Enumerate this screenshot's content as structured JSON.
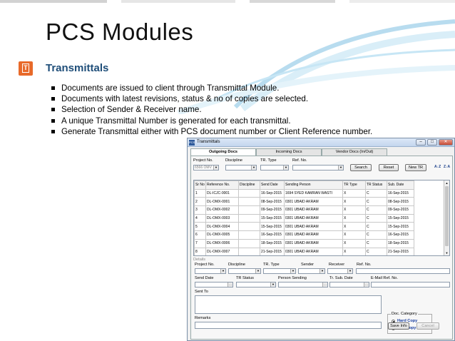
{
  "slide": {
    "title": "PCS Modules",
    "section_icon": "document-icon",
    "section_title": "Transmittals",
    "bullets": [
      "Documents are issued to client through Transmittal Module.",
      "Documents with latest revisions, status & no of copies are selected.",
      "Selection of Sender & Receiver name.",
      "A unique Transmittal Number is generated for each transmittal.",
      "Generate Transmittal either with PCS document number or Client Reference number."
    ],
    "colors": {
      "title": "#111111",
      "section_title": "#1f4e79",
      "icon_bg": "#e86a2a"
    }
  },
  "window": {
    "title": "Transmittals",
    "app_icon": "PCS",
    "buttons": {
      "minimize": "–",
      "restore": "□",
      "close": "✕"
    },
    "tabs": [
      {
        "label": "Outgoing Docs",
        "active": true
      },
      {
        "label": "Incoming Docs",
        "active": false
      },
      {
        "label": "Vendor Docs (In/Out)",
        "active": false
      }
    ],
    "filters": {
      "project_no_label": "Project No.",
      "project_no_value": "6566 OMV",
      "discipline_label": "Discipline",
      "tr_type_label": "TR. Type",
      "ref_no_label": "Ref. No.",
      "search_button": "Search",
      "reset_button": "Reset",
      "new_tr_button": "New TR",
      "sort_asc": "A↓Z",
      "sort_desc": "Z↓A"
    },
    "grid": {
      "columns": [
        "Sr No",
        "Reference No.",
        "Discipline",
        "Send Date",
        "Sending Person",
        "TR Type",
        "TR Status",
        "Sub. Date"
      ],
      "rows": [
        [
          "1",
          "DL-ICJC-0001",
          "",
          "16-Sep-2015",
          "1694 SYED KAMRAN WASTI",
          "X",
          "C",
          "16-Sep-2015"
        ],
        [
          "2",
          "DL-OMX-0001",
          "",
          "08-Sep-2015",
          "0301 UBAID AKRAM",
          "X",
          "C",
          "08-Sep-2015"
        ],
        [
          "3",
          "DL-OMX-0002",
          "",
          "09-Sep-2015",
          "0301 UBAID AKRAM",
          "X",
          "C",
          "09-Sep-2015"
        ],
        [
          "4",
          "DL-OMX-0003",
          "",
          "15-Sep-2015",
          "0301 UBAID AKRAM",
          "X",
          "C",
          "15-Sep-2015"
        ],
        [
          "5",
          "DL-OMX-0004",
          "",
          "15-Sep-2015",
          "0301 UBAID AKRAM",
          "X",
          "C",
          "15-Sep-2015"
        ],
        [
          "6",
          "DL-OMX-0005",
          "",
          "16-Sep-2015",
          "0301 UBAID AKRAM",
          "X",
          "C",
          "16-Sep-2015"
        ],
        [
          "7",
          "DL-OMX-0006",
          "",
          "18-Sep-2015",
          "0301 UBAID AKRAM",
          "X",
          "C",
          "18-Sep-2015"
        ],
        [
          "8",
          "DL-OMX-0007",
          "",
          "21-Sep-2015",
          "0301 UBAID AKRAM",
          "X",
          "C",
          "21-Sep-2015"
        ]
      ]
    },
    "details": {
      "section_label": "Details",
      "project_no_label": "Project No.",
      "discipline_label": "Discipline",
      "tr_type_label": "TR. Type",
      "sender_label": "Sender",
      "receiver_label": "Receiver",
      "ref_no_label": "Ref. No.",
      "send_date_label": "Send Date",
      "tr_status_label": "TR Status",
      "person_sending_label": "Person Sending",
      "tr_sub_date_label": "Tr. Sub. Date",
      "email_ref_no_label": "E-Mail Ref. No.",
      "sent_to_label": "Sent To",
      "remarks_label": "Remarks",
      "doc_category_label": "Doc. Category",
      "hard_copy_label": "Hard Copy",
      "soft_copy_label": "Soft Copy",
      "doc_category_selected": "Hard Copy",
      "save_button": "Save Info",
      "cancel_button": "Cancel"
    }
  }
}
